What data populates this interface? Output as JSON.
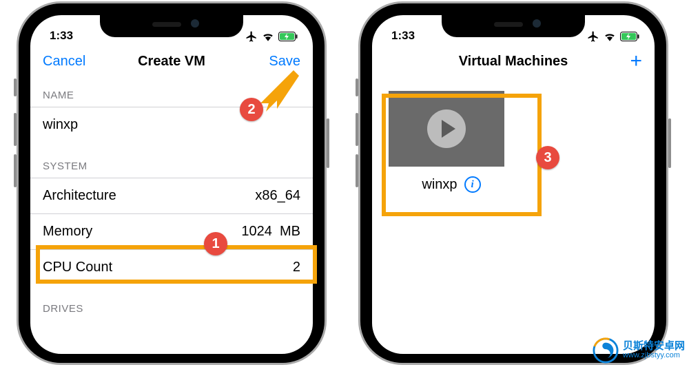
{
  "colors": {
    "ios_blue": "#007aff",
    "highlight": "#f5a30a",
    "annotation": "#e84a3f"
  },
  "status": {
    "time": "1:33"
  },
  "left": {
    "nav": {
      "cancel": "Cancel",
      "title": "Create VM",
      "save": "Save"
    },
    "section_name_header": "NAME",
    "name_value": "winxp",
    "section_system_header": "SYSTEM",
    "rows": {
      "architecture": {
        "label": "Architecture",
        "value": "x86_64"
      },
      "memory": {
        "label": "Memory",
        "value": "1024",
        "unit": "MB"
      },
      "cpu": {
        "label": "CPU Count",
        "value": "2"
      }
    },
    "section_drives_header": "DRIVES"
  },
  "right": {
    "nav": {
      "title": "Virtual Machines"
    },
    "vm": {
      "name": "winxp"
    }
  },
  "annotations": {
    "n1": "1",
    "n2": "2",
    "n3": "3"
  },
  "watermark": {
    "cn": "贝斯特安卓网",
    "en": "www.zjbstyy.com"
  }
}
